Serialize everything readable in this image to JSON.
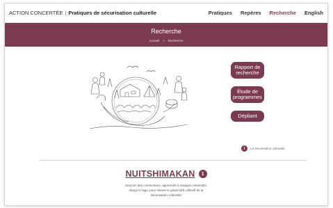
{
  "brand": {
    "prefix": "ACTION CONCERTÉE",
    "separator": "|",
    "title": "Pratiques de sécurisation culturelle"
  },
  "nav": {
    "items": [
      {
        "label": "Pratiques",
        "active": false
      },
      {
        "label": "Repères",
        "active": false
      },
      {
        "label": "Recherche",
        "active": true
      },
      {
        "label": "English",
        "active": false
      }
    ]
  },
  "banner": {
    "title": "Recherche",
    "breadcrumb": [
      "Accueil",
      "»",
      "Recherche"
    ]
  },
  "actions": {
    "rapport": "Rapport de recherche",
    "etude": "Étude de programmes",
    "depliant": "Dépliant"
  },
  "info": {
    "icon_label": "i",
    "text": "La sécurisation culturelle"
  },
  "section": {
    "title": "NUITSHIMAKAN",
    "number": "1",
    "description_lines": [
      "Sources des connecteurs, apprendre à naviguer ensemble,",
      "élargir le lago, pour relever le grand défi collectif de la",
      "sécurisation culturelle!"
    ]
  },
  "colors": {
    "accent": "#7a3a52",
    "illustration_ink": "#555555"
  }
}
